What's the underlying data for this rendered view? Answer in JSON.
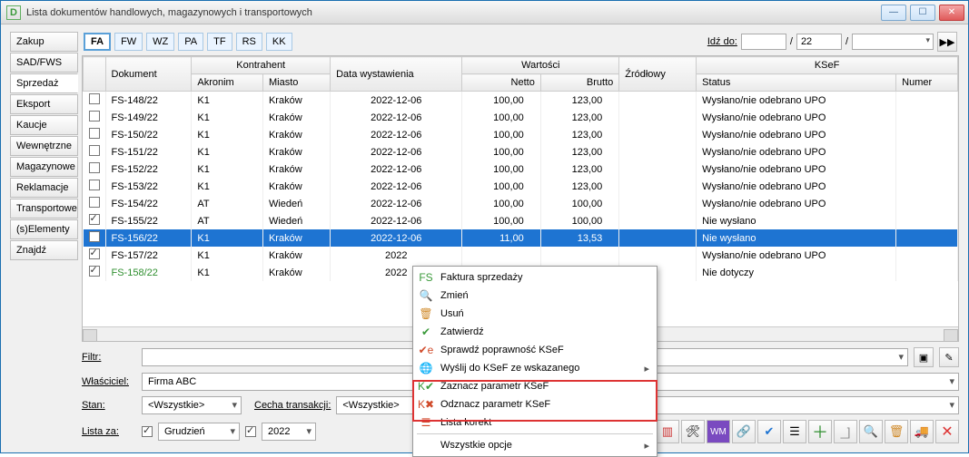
{
  "window": {
    "title": "Lista dokumentów handlowych, magazynowych i transportowych",
    "icon": "D"
  },
  "side_tabs": [
    "Zakup",
    "SAD/FWS",
    "Sprzedaż",
    "Eksport",
    "Kaucje",
    "Wewnętrzne",
    "Magazynowe",
    "Reklamacje",
    "Transportowe",
    "(s)Elementy",
    "Znajdź"
  ],
  "side_selected": 2,
  "top_tabs": [
    "FA",
    "FW",
    "WZ",
    "PA",
    "TF",
    "RS",
    "KK"
  ],
  "top_active": 0,
  "goto": {
    "label": "Idź do:",
    "val1": "",
    "sep": "/",
    "val2": "22",
    "year_combo": ""
  },
  "columns": {
    "dokument": "Dokument",
    "kontrahent_group": "Kontrahent",
    "akronim": "Akronim",
    "miasto": "Miasto",
    "data": "Data wystawienia",
    "wartosci_group": "Wartości",
    "netto": "Netto",
    "brutto": "Brutto",
    "zrodlowy": "Źródłowy",
    "ksef_group": "KSeF",
    "status": "Status",
    "numer": "Numer"
  },
  "rows": [
    {
      "chk": false,
      "doc": "FS-148/22",
      "akr": "K1",
      "miasto": "Kraków",
      "data": "2022-12-06",
      "netto": "100,00",
      "brutto": "123,00",
      "status": "Wysłano/nie odebrano UPO"
    },
    {
      "chk": false,
      "doc": "FS-149/22",
      "akr": "K1",
      "miasto": "Kraków",
      "data": "2022-12-06",
      "netto": "100,00",
      "brutto": "123,00",
      "status": "Wysłano/nie odebrano UPO"
    },
    {
      "chk": false,
      "doc": "FS-150/22",
      "akr": "K1",
      "miasto": "Kraków",
      "data": "2022-12-06",
      "netto": "100,00",
      "brutto": "123,00",
      "status": "Wysłano/nie odebrano UPO"
    },
    {
      "chk": false,
      "doc": "FS-151/22",
      "akr": "K1",
      "miasto": "Kraków",
      "data": "2022-12-06",
      "netto": "100,00",
      "brutto": "123,00",
      "status": "Wysłano/nie odebrano UPO"
    },
    {
      "chk": false,
      "doc": "FS-152/22",
      "akr": "K1",
      "miasto": "Kraków",
      "data": "2022-12-06",
      "netto": "100,00",
      "brutto": "123,00",
      "status": "Wysłano/nie odebrano UPO"
    },
    {
      "chk": false,
      "doc": "FS-153/22",
      "akr": "K1",
      "miasto": "Kraków",
      "data": "2022-12-06",
      "netto": "100,00",
      "brutto": "123,00",
      "status": "Wysłano/nie odebrano UPO"
    },
    {
      "chk": false,
      "doc": "FS-154/22",
      "akr": "AT",
      "miasto": "Wiedeń",
      "data": "2022-12-06",
      "netto": "100,00",
      "brutto": "100,00",
      "status": "Wysłano/nie odebrano UPO"
    },
    {
      "chk": true,
      "doc": "FS-155/22",
      "akr": "AT",
      "miasto": "Wiedeń",
      "data": "2022-12-06",
      "netto": "100,00",
      "brutto": "100,00",
      "status": "Nie wysłano"
    },
    {
      "chk": true,
      "doc": "FS-156/22",
      "akr": "K1",
      "miasto": "Kraków",
      "data": "2022-12-06",
      "netto": "11,00",
      "brutto": "13,53",
      "status": "Nie wysłano",
      "selected": true
    },
    {
      "chk": true,
      "doc": "FS-157/22",
      "akr": "K1",
      "miasto": "Kraków",
      "data": "2022",
      "netto": "",
      "brutto": "",
      "status": "Wysłano/nie odebrano UPO"
    },
    {
      "chk": true,
      "doc": "FS-158/22",
      "akr": "K1",
      "miasto": "Kraków",
      "data": "2022",
      "netto": "",
      "brutto": "",
      "status": "Nie dotyczy",
      "green": true
    }
  ],
  "form": {
    "filtr": "Filtr:",
    "wlasciciel": "Właściciel:",
    "wlasciciel_val": "Firma ABC",
    "stan": "Stan:",
    "stan_val": "<Wszystkie>",
    "cecha": "Cecha transakcji:",
    "cecha_val": "<Wszystkie>",
    "lista_za": "Lista za:",
    "miesiac": "Grudzień",
    "rok": "2022"
  },
  "context_menu": [
    {
      "icon": "FS",
      "label": "Faktura sprzedaży",
      "color": "#3a9a3a"
    },
    {
      "icon": "🔍",
      "label": "Zmień"
    },
    {
      "icon": "🗑",
      "label": "Usuń",
      "color": "#d08a2a"
    },
    {
      "icon": "✔",
      "label": "Zatwierdź",
      "color": "#3a9a3a"
    },
    {
      "icon": "✔e",
      "label": "Sprawdź poprawność KSeF",
      "color": "#d04a2a"
    },
    {
      "icon": "🌐",
      "label": "Wyślij do KSeF ze wskazanego",
      "arrow": true
    },
    {
      "icon": "K✔",
      "label": "Zaznacz parametr KSeF",
      "color": "#3a9a3a",
      "hl": true
    },
    {
      "icon": "K✖",
      "label": "Odznacz parametr KSeF",
      "color": "#d04a2a",
      "hl": true
    },
    {
      "icon": "☰",
      "label": "Lista korekt",
      "color": "#d04a2a"
    },
    {
      "sep": true
    },
    {
      "label": "Wszystkie opcje",
      "arrow": true
    }
  ]
}
